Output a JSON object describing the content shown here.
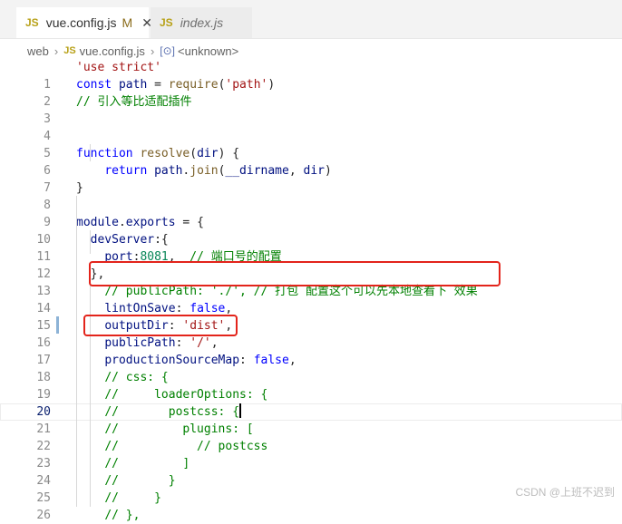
{
  "tabs": [
    {
      "icon": "JS",
      "label": "vue.config.js",
      "status": "M",
      "close": "✕",
      "active": true
    },
    {
      "icon": "JS",
      "label": "index.js",
      "active": false
    }
  ],
  "breadcrumb": {
    "folder": "web",
    "file_icon": "JS",
    "file": "vue.config.js",
    "symbol_icon": "[⊙]",
    "symbol": "<unknown>"
  },
  "lines": [
    {
      "n": "",
      "tokens": [
        {
          "c": "str",
          "t": "'use strict'"
        }
      ]
    },
    {
      "n": "1",
      "tokens": [
        {
          "c": "kw",
          "t": "const "
        },
        {
          "c": "prop",
          "t": "path"
        },
        {
          "c": "",
          "t": " = "
        },
        {
          "c": "fn",
          "t": "require"
        },
        {
          "c": "",
          "t": "("
        },
        {
          "c": "str",
          "t": "'path'"
        },
        {
          "c": "",
          "t": ")"
        }
      ]
    },
    {
      "n": "2",
      "tokens": [
        {
          "c": "com",
          "t": "// 引入等比适配插件"
        }
      ]
    },
    {
      "n": "3",
      "tokens": []
    },
    {
      "n": "4",
      "tokens": []
    },
    {
      "n": "5",
      "tokens": [
        {
          "c": "kw",
          "t": "function "
        },
        {
          "c": "fn",
          "t": "resolve"
        },
        {
          "c": "",
          "t": "("
        },
        {
          "c": "prop",
          "t": "dir"
        },
        {
          "c": "",
          "t": ") {"
        }
      ]
    },
    {
      "n": "6",
      "tokens": [
        {
          "c": "",
          "t": "    "
        },
        {
          "c": "kw",
          "t": "return "
        },
        {
          "c": "prop",
          "t": "path"
        },
        {
          "c": "",
          "t": "."
        },
        {
          "c": "fn",
          "t": "join"
        },
        {
          "c": "",
          "t": "("
        },
        {
          "c": "prop",
          "t": "__dirname"
        },
        {
          "c": "",
          "t": ", "
        },
        {
          "c": "prop",
          "t": "dir"
        },
        {
          "c": "",
          "t": ")"
        }
      ]
    },
    {
      "n": "7",
      "tokens": [
        {
          "c": "",
          "t": "}"
        }
      ]
    },
    {
      "n": "8",
      "tokens": []
    },
    {
      "n": "9",
      "tokens": [
        {
          "c": "prop",
          "t": "module"
        },
        {
          "c": "",
          "t": "."
        },
        {
          "c": "prop",
          "t": "exports"
        },
        {
          "c": "",
          "t": " = {"
        }
      ]
    },
    {
      "n": "10",
      "tokens": [
        {
          "c": "",
          "t": "  "
        },
        {
          "c": "prop",
          "t": "devServer"
        },
        {
          "c": "",
          "t": ":{"
        }
      ]
    },
    {
      "n": "11",
      "tokens": [
        {
          "c": "",
          "t": "    "
        },
        {
          "c": "prop",
          "t": "port"
        },
        {
          "c": "",
          "t": ":"
        },
        {
          "c": "num",
          "t": "8081"
        },
        {
          "c": "",
          "t": ",  "
        },
        {
          "c": "com",
          "t": "// 端口号的配置"
        }
      ]
    },
    {
      "n": "12",
      "tokens": [
        {
          "c": "",
          "t": "  },"
        }
      ]
    },
    {
      "n": "13",
      "tokens": [
        {
          "c": "",
          "t": "    "
        },
        {
          "c": "com",
          "t": "// publicPath: './', // 打包 配置这个可以先本地查看下 效果"
        }
      ]
    },
    {
      "n": "14",
      "tokens": [
        {
          "c": "",
          "t": "    "
        },
        {
          "c": "prop",
          "t": "lintOnSave"
        },
        {
          "c": "",
          "t": ": "
        },
        {
          "c": "kw",
          "t": "false"
        },
        {
          "c": "",
          "t": ","
        }
      ]
    },
    {
      "n": "15",
      "tokens": [
        {
          "c": "",
          "t": "    "
        },
        {
          "c": "prop",
          "t": "outputDir"
        },
        {
          "c": "",
          "t": ": "
        },
        {
          "c": "str",
          "t": "'dist'"
        },
        {
          "c": "",
          "t": ","
        }
      ]
    },
    {
      "n": "16",
      "tokens": [
        {
          "c": "",
          "t": "    "
        },
        {
          "c": "prop",
          "t": "publicPath"
        },
        {
          "c": "",
          "t": ": "
        },
        {
          "c": "str",
          "t": "'/'"
        },
        {
          "c": "",
          "t": ","
        }
      ]
    },
    {
      "n": "17",
      "tokens": [
        {
          "c": "",
          "t": "    "
        },
        {
          "c": "prop",
          "t": "productionSourceMap"
        },
        {
          "c": "",
          "t": ": "
        },
        {
          "c": "kw",
          "t": "false"
        },
        {
          "c": "",
          "t": ","
        }
      ]
    },
    {
      "n": "18",
      "tokens": [
        {
          "c": "",
          "t": "    "
        },
        {
          "c": "com",
          "t": "// css: {"
        }
      ]
    },
    {
      "n": "19",
      "tokens": [
        {
          "c": "",
          "t": "    "
        },
        {
          "c": "com",
          "t": "//     loaderOptions: {"
        }
      ]
    },
    {
      "n": "20",
      "tokens": [
        {
          "c": "",
          "t": "    "
        },
        {
          "c": "com",
          "t": "//       postcss: {"
        }
      ],
      "current": true
    },
    {
      "n": "21",
      "tokens": [
        {
          "c": "",
          "t": "    "
        },
        {
          "c": "com",
          "t": "//         plugins: ["
        }
      ]
    },
    {
      "n": "22",
      "tokens": [
        {
          "c": "",
          "t": "    "
        },
        {
          "c": "com",
          "t": "//           // postcss"
        }
      ]
    },
    {
      "n": "23",
      "tokens": [
        {
          "c": "",
          "t": "    "
        },
        {
          "c": "com",
          "t": "//         ]"
        }
      ]
    },
    {
      "n": "24",
      "tokens": [
        {
          "c": "",
          "t": "    "
        },
        {
          "c": "com",
          "t": "//       }"
        }
      ]
    },
    {
      "n": "25",
      "tokens": [
        {
          "c": "",
          "t": "    "
        },
        {
          "c": "com",
          "t": "//     }"
        }
      ]
    },
    {
      "n": "26",
      "tokens": [
        {
          "c": "",
          "t": "    "
        },
        {
          "c": "com",
          "t": "// },"
        }
      ]
    }
  ],
  "watermark": "CSDN @上班不迟到"
}
